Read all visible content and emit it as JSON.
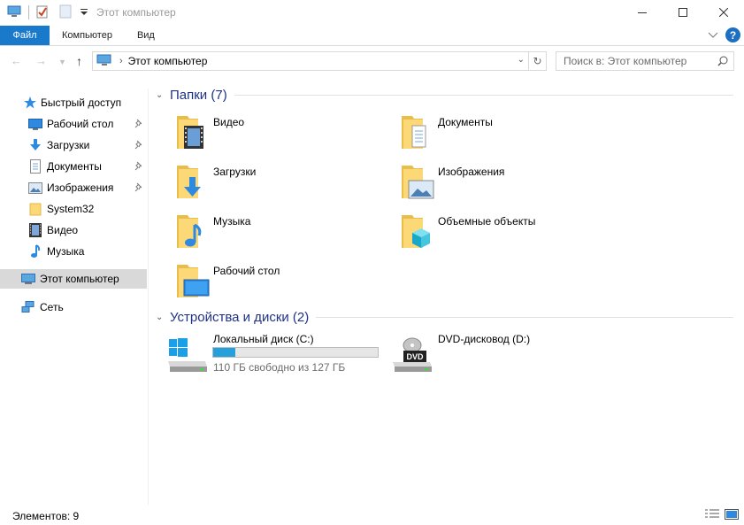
{
  "window": {
    "title": "Этот компьютер"
  },
  "ribbon": {
    "tabs": [
      "Файл",
      "Компьютер",
      "Вид"
    ]
  },
  "address": {
    "path": "Этот компьютер",
    "search_placeholder": "Поиск в: Этот компьютер"
  },
  "sidebar": {
    "items": [
      {
        "label": "Быстрый доступ",
        "icon": "star-icon",
        "pinned": false
      },
      {
        "label": "Рабочий стол",
        "icon": "desktop-icon",
        "pinned": true
      },
      {
        "label": "Загрузки",
        "icon": "download-icon",
        "pinned": true
      },
      {
        "label": "Документы",
        "icon": "documents-icon",
        "pinned": true
      },
      {
        "label": "Изображения",
        "icon": "pictures-icon",
        "pinned": true
      },
      {
        "label": "System32",
        "icon": "folder-icon",
        "pinned": false
      },
      {
        "label": "Видео",
        "icon": "video-icon",
        "pinned": false
      },
      {
        "label": "Музыка",
        "icon": "music-icon",
        "pinned": false
      },
      {
        "label": "Этот компьютер",
        "icon": "computer-icon",
        "selected": true
      },
      {
        "label": "Сеть",
        "icon": "network-icon",
        "pinned": false
      }
    ]
  },
  "main": {
    "folders_group": "Папки (7)",
    "folders": [
      {
        "label": "Видео",
        "icon": "video-folder-icon"
      },
      {
        "label": "Документы",
        "icon": "documents-folder-icon"
      },
      {
        "label": "Загрузки",
        "icon": "downloads-folder-icon"
      },
      {
        "label": "Изображения",
        "icon": "pictures-folder-icon"
      },
      {
        "label": "Музыка",
        "icon": "music-folder-icon"
      },
      {
        "label": "Объемные объекты",
        "icon": "3d-objects-folder-icon"
      },
      {
        "label": "Рабочий стол",
        "icon": "desktop-folder-icon"
      }
    ],
    "devices_group": "Устройства и диски (2)",
    "devices": [
      {
        "label": "Локальный диск (C:)",
        "free": "110 ГБ свободно из 127 ГБ",
        "used_fraction": 0.134,
        "icon": "windows-drive-icon"
      },
      {
        "label": "DVD-дисковод (D:)",
        "icon": "dvd-drive-icon",
        "badge": "DVD"
      }
    ]
  },
  "status": {
    "items_count": "Элементов: 9"
  },
  "colors": {
    "accent": "#1979ca",
    "selection": "#d9d9d9",
    "group_title": "#1e3287",
    "progress": "#26a0da"
  }
}
